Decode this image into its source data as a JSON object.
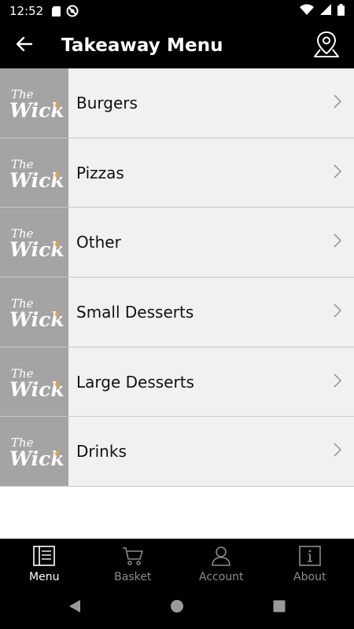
{
  "status_bar": {
    "time": "12:52",
    "icons": [
      "sd-card-icon",
      "vpn-icon",
      "wifi-icon",
      "signal-icon",
      "battery-icon"
    ]
  },
  "app_bar": {
    "title": "Takeaway Menu",
    "back_icon": "arrow-left-icon",
    "location_icon": "map-pin-icon"
  },
  "menu": {
    "thumb_logo": "The Wick",
    "items": [
      {
        "label": "Burgers"
      },
      {
        "label": "Pizzas"
      },
      {
        "label": "Other"
      },
      {
        "label": "Small Desserts"
      },
      {
        "label": "Large Desserts"
      },
      {
        "label": "Drinks"
      }
    ]
  },
  "bottom_nav": {
    "tabs": [
      {
        "label": "Menu",
        "icon": "menu-book-icon",
        "active": true
      },
      {
        "label": "Basket",
        "icon": "cart-icon",
        "active": false
      },
      {
        "label": "Account",
        "icon": "user-icon",
        "active": false
      },
      {
        "label": "About",
        "icon": "info-icon",
        "active": false
      }
    ]
  },
  "colors": {
    "bar_bg": "#000000",
    "list_bg": "#f1f1f1",
    "thumb_bg": "#a4a4a4",
    "logo_accent": "#e8a33a",
    "inactive_nav": "#8c8c8c"
  }
}
